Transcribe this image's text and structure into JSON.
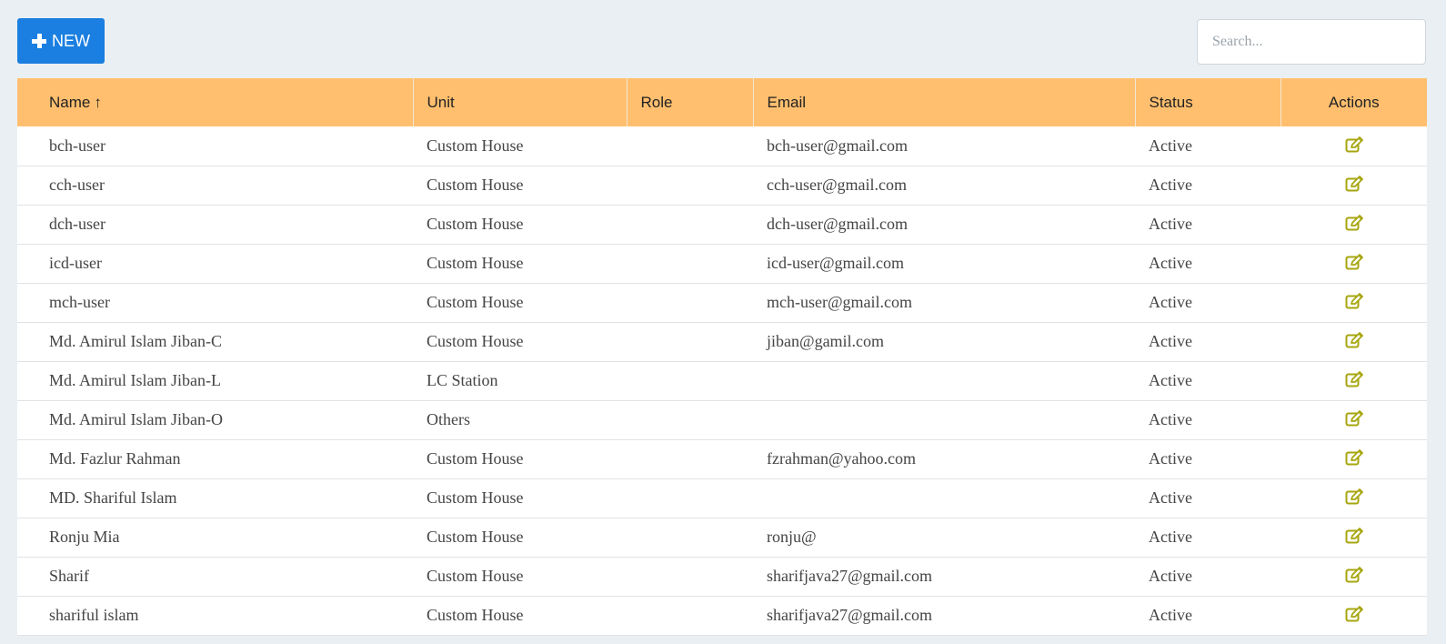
{
  "toolbar": {
    "new_label": "NEW"
  },
  "search": {
    "placeholder": "Search..."
  },
  "table": {
    "columns": [
      "Name",
      "Unit",
      "Role",
      "Email",
      "Status",
      "Actions"
    ],
    "rows": [
      {
        "name": "bch-user",
        "unit": "Custom House",
        "role": "",
        "email": "bch-user@gmail.com",
        "status": "Active"
      },
      {
        "name": "cch-user",
        "unit": "Custom House",
        "role": "",
        "email": "cch-user@gmail.com",
        "status": "Active"
      },
      {
        "name": "dch-user",
        "unit": "Custom House",
        "role": "",
        "email": "dch-user@gmail.com",
        "status": "Active"
      },
      {
        "name": "icd-user",
        "unit": "Custom House",
        "role": "",
        "email": "icd-user@gmail.com",
        "status": "Active"
      },
      {
        "name": "mch-user",
        "unit": "Custom House",
        "role": "",
        "email": "mch-user@gmail.com",
        "status": "Active"
      },
      {
        "name": "Md. Amirul Islam Jiban-C",
        "unit": "Custom House",
        "role": "",
        "email": "jiban@gamil.com",
        "status": "Active"
      },
      {
        "name": "Md. Amirul Islam Jiban-L",
        "unit": "LC Station",
        "role": "",
        "email": "",
        "status": "Active"
      },
      {
        "name": "Md. Amirul Islam Jiban-O",
        "unit": "Others",
        "role": "",
        "email": "",
        "status": "Active"
      },
      {
        "name": "Md. Fazlur Rahman",
        "unit": "Custom House",
        "role": "",
        "email": "fzrahman@yahoo.com",
        "status": "Active"
      },
      {
        "name": "MD. Shariful Islam",
        "unit": "Custom House",
        "role": "",
        "email": "",
        "status": "Active"
      },
      {
        "name": "Ronju Mia",
        "unit": "Custom House",
        "role": "",
        "email": "ronju@",
        "status": "Active"
      },
      {
        "name": "Sharif",
        "unit": "Custom House",
        "role": "",
        "email": "sharifjava27@gmail.com",
        "status": "Active"
      },
      {
        "name": "shariful islam",
        "unit": "Custom House",
        "role": "",
        "email": "sharifjava27@gmail.com",
        "status": "Active"
      }
    ]
  },
  "icons": {
    "edit": "edit-icon",
    "sort": "arrow-up-icon",
    "new": "plus-icon"
  },
  "colors": {
    "header_bg": "#ffbf6f",
    "primary": "#1a7fe0",
    "edit_icon": "#a7a60f"
  }
}
